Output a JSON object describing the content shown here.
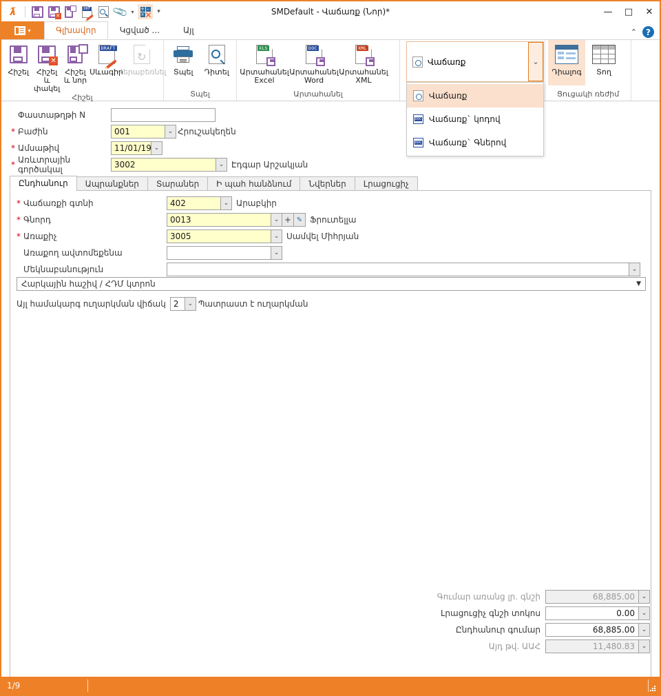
{
  "window": {
    "title": "SMDefault - Վաճառք (Նոր)*",
    "minimize": "—",
    "maximize": "□",
    "close": "✕"
  },
  "quick_access": {
    "icons": [
      "app-logo",
      "save-icon",
      "save-and-close-icon",
      "save-and-new-icon",
      "draft-icon",
      "preview-icon",
      "attachment-icon",
      "attachment-dropdown-caret",
      "add-remove-icon",
      "customize-qat-caret"
    ]
  },
  "ribbon": {
    "file_menu_label": "",
    "tabs": [
      {
        "label": "Գլխավոր",
        "active": true
      },
      {
        "label": "Կցված ...",
        "active": false
      },
      {
        "label": "Այլ",
        "active": false
      }
    ],
    "collapse_caret": "⌃",
    "help_label": "?",
    "groups": [
      {
        "label": "Հիշել",
        "buttons": [
          {
            "label": "Հիշել",
            "icon": "floppy-icon",
            "disabled": false
          },
          {
            "label": "Հիշել և\nփակել",
            "line1": "Հիշել և",
            "line2": "փակել",
            "icon": "floppy-close-icon",
            "disabled": false
          },
          {
            "label": "Հիշել\nև նոր",
            "line1": "Հիշել",
            "line2": "և նոր",
            "icon": "floppy-new-icon",
            "disabled": false
          },
          {
            "label": "Սևագիր",
            "icon": "draft-doc-icon",
            "disabled": false
          },
          {
            "label": "Վերաբեռնել",
            "icon": "reload-icon",
            "disabled": true
          }
        ]
      },
      {
        "label": "Տպել",
        "buttons": [
          {
            "label": "Տպել",
            "icon": "printer-icon",
            "disabled": false
          },
          {
            "label": "Դիտել",
            "icon": "preview-doc-icon",
            "disabled": false
          }
        ]
      },
      {
        "label": "Արտահանել",
        "buttons": [
          {
            "label": "Արտահանել\nExcel",
            "line1": "Արտահանել",
            "line2": "Excel",
            "icon": "export-excel-icon",
            "disabled": false
          },
          {
            "label": "Արտահանել\nWord",
            "line1": "Արտահանել",
            "line2": "Word",
            "icon": "export-word-icon",
            "disabled": false
          },
          {
            "label": "Արտահանել\nXML",
            "line1": "Արտահանել",
            "line2": "XML",
            "icon": "export-xml-icon",
            "disabled": false
          }
        ]
      },
      {
        "label": "Ցուցակի ռեժիմ",
        "buttons": [
          {
            "label": "Դիալոգ",
            "icon": "dialog-view-icon",
            "selected": true
          },
          {
            "label": "Տող",
            "icon": "grid-view-icon",
            "selected": false
          }
        ]
      }
    ],
    "print_combo": {
      "value": "Վաճառք",
      "icon": "report-preview-icon",
      "caret": "⌄",
      "menu_items": [
        {
          "label": "Վաճառք",
          "icon": "report-preview-icon",
          "highlighted": true
        },
        {
          "label": "Վաճառք` կոդով",
          "icon": "doc-icon",
          "highlighted": false
        },
        {
          "label": "Վաճառք` Գներով",
          "icon": "doc-icon",
          "highlighted": false
        }
      ]
    }
  },
  "header_fields": [
    {
      "required": false,
      "label": "Փաստաթղթի N",
      "value": "",
      "type": "text",
      "tail": ""
    },
    {
      "required": true,
      "label": "Բաժին",
      "value": "001",
      "type": "combo",
      "tail": "Հրուշակեղեն"
    },
    {
      "required": true,
      "label": "Ամսաթիվ",
      "value": "11/01/19",
      "type": "combo",
      "tail": ""
    },
    {
      "required": true,
      "label": "Առևտրային գործակալ",
      "value": "3002",
      "type": "combo",
      "tail": "Էդգար Արշակյան"
    }
  ],
  "tabs": [
    {
      "label": "Ընդհանուր",
      "active": true
    },
    {
      "label": "Ապրանքներ",
      "active": false
    },
    {
      "label": "Տարաներ",
      "active": false
    },
    {
      "label": "Ի պահ հանձնում",
      "active": false
    },
    {
      "label": "Նվերներ",
      "active": false
    },
    {
      "label": "Լրացուցիչ",
      "active": false
    }
  ],
  "general_tab": {
    "fields": [
      {
        "required": true,
        "label": "Վաճառքի գտնի",
        "value": "402",
        "tail": "Արաբկիր",
        "kind": "combo-small"
      },
      {
        "required": true,
        "label": "Գնորդ",
        "value": "0013",
        "tail": "Ֆրուտելլա",
        "kind": "combo-edit"
      },
      {
        "required": true,
        "label": "Առաքիչ",
        "value": "3005",
        "tail": "Սամվել Միհրյան",
        "kind": "combo-med"
      },
      {
        "required": false,
        "label": "Առաքող ավտոմեքենա",
        "value": "",
        "tail": "",
        "kind": "combo-empty"
      },
      {
        "required": false,
        "label": "Մեկնաբանություն",
        "value": "",
        "tail": "",
        "kind": "combo-wide"
      }
    ],
    "section_bar": {
      "label": "Հարկային հաշիվ / ՀԴՄ կտրոն",
      "caret": "▼"
    },
    "shipment_row": {
      "label": "Այլ համակարգ ուղարկման վիճակ",
      "value": "2",
      "tail": "Պատրաստ է ուղարկման"
    }
  },
  "totals": [
    {
      "label": "Գումար առանց լր. գնշի",
      "value": "68,885.00",
      "readonly": true
    },
    {
      "label": "Լրացուցիչ գնշի տոկոս",
      "value": "0.00",
      "readonly": false
    },
    {
      "label": "Ընդհանուր գումար",
      "value": "68,885.00",
      "readonly": false
    },
    {
      "label": "Այդ թվ. ԱԱՀ",
      "value": "11,480.83",
      "readonly": true
    }
  ],
  "statusbar": {
    "page": "1/9",
    "right_segment": ""
  },
  "colors": {
    "accent": "#ee8127",
    "required_star": "#d0021b",
    "field_yellow": "#ffffcc",
    "menu_highlight": "#fbe0ce",
    "readonly_text": "#9a9a9a"
  }
}
